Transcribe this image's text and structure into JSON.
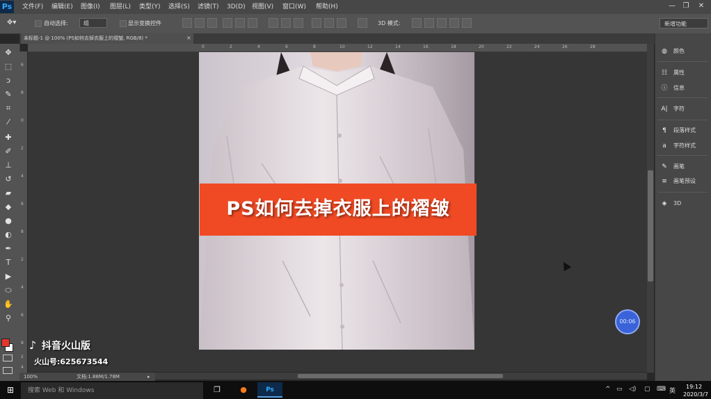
{
  "app": {
    "logo": "Ps"
  },
  "menu": [
    "文件(F)",
    "编辑(E)",
    "图像(I)",
    "图层(L)",
    "类型(Y)",
    "选择(S)",
    "滤镜(T)",
    "3D(D)",
    "视图(V)",
    "窗口(W)",
    "帮助(H)"
  ],
  "window_controls": {
    "minimize": "—",
    "restore": "❐",
    "close": "✕"
  },
  "options": {
    "auto_select_label": "自动选择:",
    "auto_select_value": "组",
    "show_transform_label": "显示变换控件",
    "mode_3d_label": "3D 模式:",
    "workspace": "新增功能"
  },
  "document": {
    "tab_title": "未标题-1 @ 100% (PS如何去掉衣服上的褶皱, RGB/8) *",
    "zoom": "100%",
    "doc_info": "文档:1.88M/1.78M"
  },
  "ruler": {
    "top_ticks": [
      "0",
      "2",
      "4",
      "6",
      "8",
      "10",
      "12",
      "14",
      "16",
      "18",
      "20",
      "22",
      "24",
      "26",
      "28"
    ],
    "left_ticks": [
      "6",
      "8",
      "0",
      "2",
      "4",
      "6",
      "8",
      "2",
      "4",
      "6",
      "8",
      "2",
      "4"
    ]
  },
  "tools": [
    {
      "name": "move-tool-icon",
      "glyph": "✥"
    },
    {
      "name": "marquee-tool-icon",
      "glyph": "⬚"
    },
    {
      "name": "lasso-tool-icon",
      "glyph": "ↄ"
    },
    {
      "name": "quick-select-tool-icon",
      "glyph": "✎"
    },
    {
      "name": "crop-tool-icon",
      "glyph": "⌗"
    },
    {
      "name": "eyedropper-tool-icon",
      "glyph": "⁄"
    },
    {
      "name": "healing-brush-tool-icon",
      "glyph": "✚"
    },
    {
      "name": "brush-tool-icon",
      "glyph": "✐"
    },
    {
      "name": "clone-stamp-tool-icon",
      "glyph": "⊥"
    },
    {
      "name": "history-brush-tool-icon",
      "glyph": "↺"
    },
    {
      "name": "eraser-tool-icon",
      "glyph": "▰"
    },
    {
      "name": "paint-bucket-tool-icon",
      "glyph": "◆"
    },
    {
      "name": "blur-tool-icon",
      "glyph": "●"
    },
    {
      "name": "dodge-tool-icon",
      "glyph": "◐"
    },
    {
      "name": "pen-tool-icon",
      "glyph": "✒"
    },
    {
      "name": "type-tool-icon",
      "glyph": "T"
    },
    {
      "name": "path-select-tool-icon",
      "glyph": "▶"
    },
    {
      "name": "ellipse-tool-icon",
      "glyph": "⬭"
    },
    {
      "name": "hand-tool-icon",
      "glyph": "✋"
    },
    {
      "name": "zoom-tool-icon",
      "glyph": "⚲"
    }
  ],
  "panels": [
    {
      "icon": "◍",
      "label": "颜色"
    },
    {
      "icon": "☷",
      "label": "属性"
    },
    {
      "icon": "ⓘ",
      "label": "信息"
    },
    {
      "icon": "A|",
      "label": "字符"
    },
    {
      "icon": "¶",
      "label": "段落样式"
    },
    {
      "icon": "a",
      "label": "字符样式"
    },
    {
      "icon": "✎",
      "label": "画笔"
    },
    {
      "icon": "≡",
      "label": "画笔预设"
    },
    {
      "icon": "◈",
      "label": "3D"
    }
  ],
  "overlay": {
    "banner_text": "PS如何去掉衣服上的褶皱",
    "timer": "00:06",
    "watermark_name": "抖音火山版",
    "watermark_id": "火山号:625673544"
  },
  "taskbar": {
    "search_placeholder": "搜索 Web 和 Windows",
    "ps_label": "Ps",
    "ime": "英",
    "time": "19:12",
    "date": "2020/3/7"
  },
  "colors": {
    "foreground": "#e8352a",
    "background": "#ffffff",
    "banner": "#f04a24",
    "timer": "#3a63d9"
  }
}
